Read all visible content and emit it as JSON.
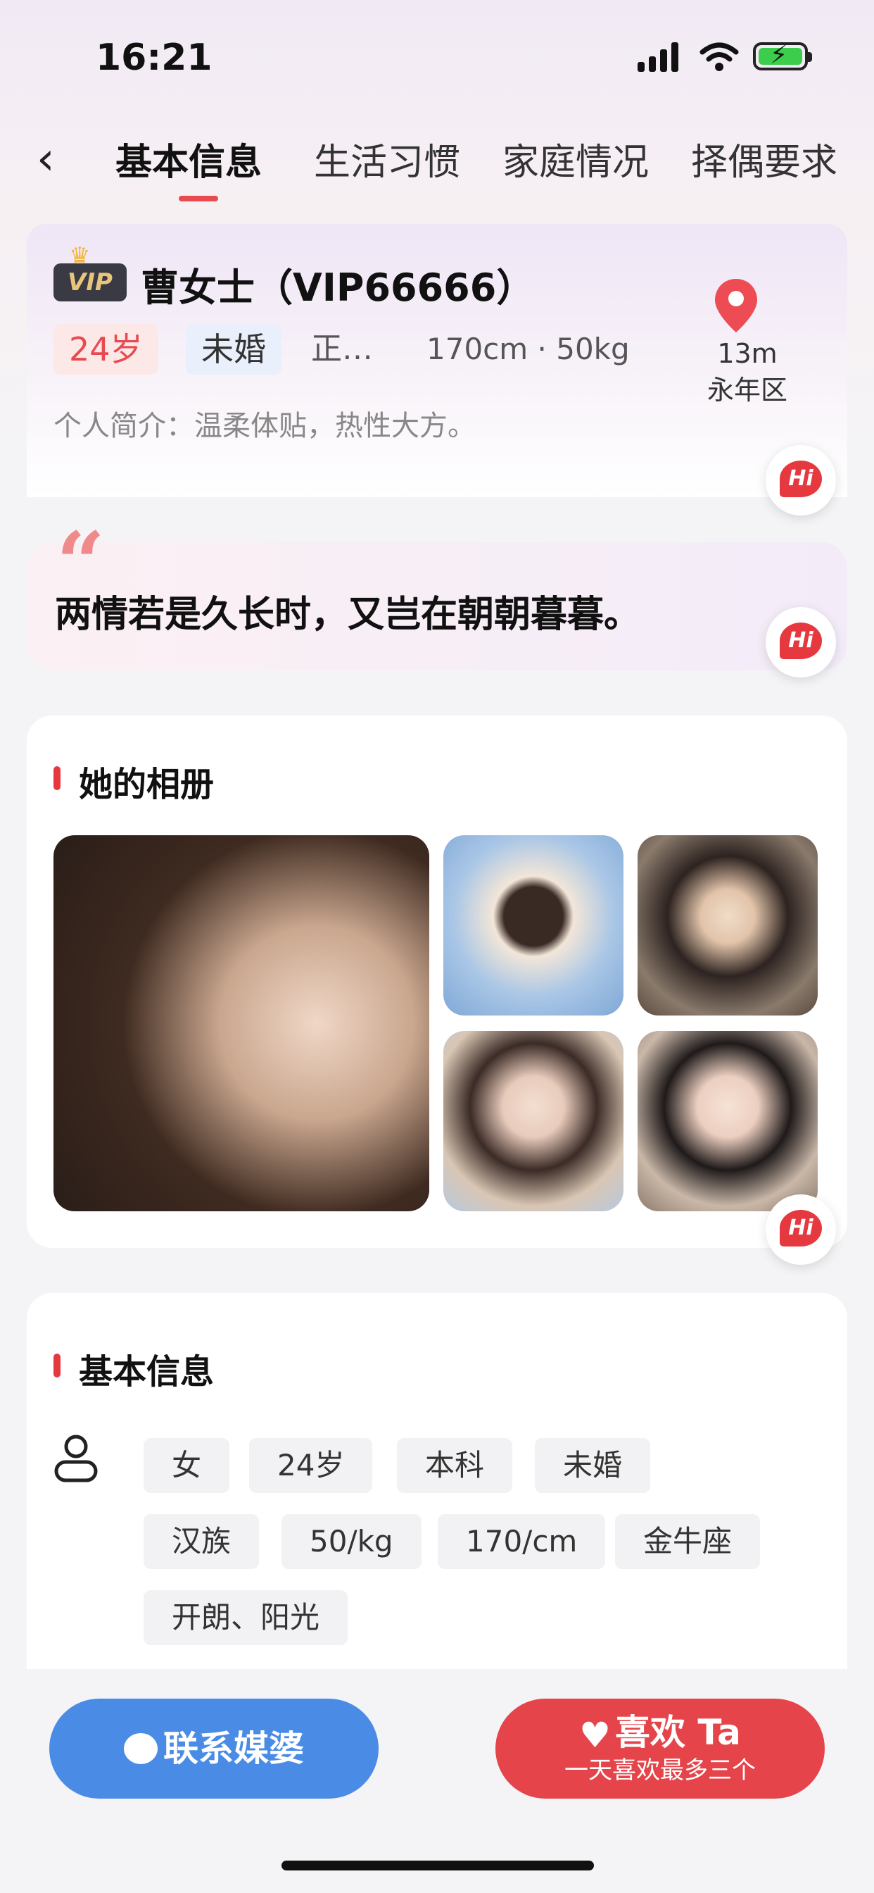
{
  "status_bar": {
    "time": "16:21"
  },
  "nav": {
    "tabs": [
      {
        "label": "基本信息",
        "active": true
      },
      {
        "label": "生活习惯",
        "active": false
      },
      {
        "label": "家庭情况",
        "active": false
      },
      {
        "label": "择偶要求",
        "active": false
      }
    ]
  },
  "profile": {
    "badge": "VIP",
    "name": "曹女士（VIP66666）",
    "age_tag": "24岁",
    "marital_tag": "未婚",
    "job": "正…",
    "height_weight": "170cm · 50kg",
    "intro": "个人简介：温柔体贴，热性大方。",
    "distance": "13m",
    "district": "永年区",
    "hi_label": "Hi"
  },
  "quote": {
    "text": "两情若是久长时，又岂在朝朝暮暮。",
    "hi_label": "Hi"
  },
  "album": {
    "title": "她的相册",
    "photos": [
      "photo-1",
      "photo-2",
      "photo-3",
      "photo-4",
      "photo-5"
    ],
    "hi_label": "Hi"
  },
  "basic_info": {
    "title": "基本信息",
    "tags": [
      "女",
      "24岁",
      "本科",
      "未婚",
      "汉族",
      "50/kg",
      "170/cm",
      "金牛座",
      "开朗、阳光"
    ]
  },
  "actions": {
    "contact_label": "联系媒婆",
    "like_label": "喜欢 Ta",
    "like_sub": "一天喜欢最多三个"
  },
  "colors": {
    "accent": "#e5393f",
    "contact_button": "#4a8be6",
    "like_button": "#e5454a"
  }
}
